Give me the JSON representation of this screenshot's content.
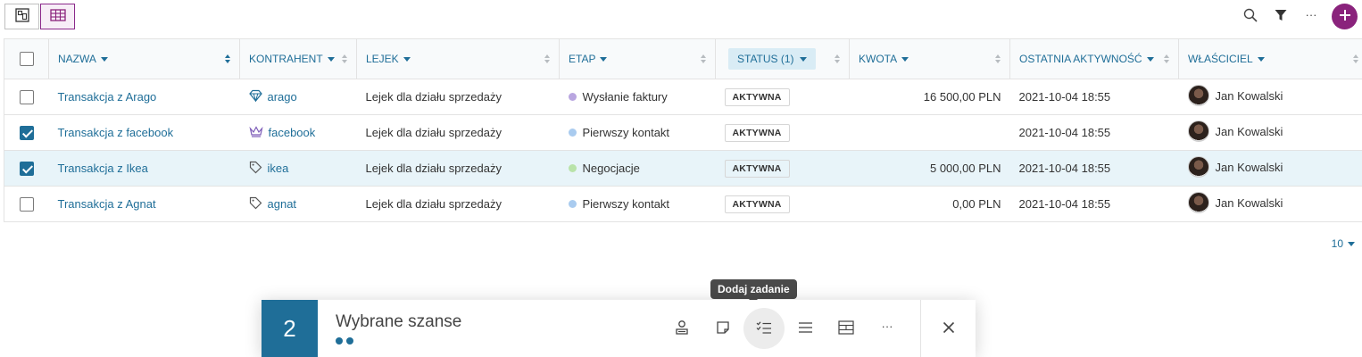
{
  "toolbar": {
    "view_toggle": [
      {
        "name": "kanban-view-icon",
        "active": false
      },
      {
        "name": "table-view-icon",
        "active": true
      }
    ],
    "actions": [
      "search-icon",
      "filter-icon",
      "more-icon",
      "add-icon"
    ],
    "more_glyph": "···",
    "accent_color": "#8a237c"
  },
  "table": {
    "columns": [
      {
        "key": "select",
        "label": ""
      },
      {
        "key": "name",
        "label": "NAZWA",
        "dropdown": true,
        "sort_active": true
      },
      {
        "key": "contractor",
        "label": "KONTRAHENT",
        "dropdown": true
      },
      {
        "key": "funnel",
        "label": "LEJEK",
        "dropdown": true
      },
      {
        "key": "stage",
        "label": "ETAP",
        "dropdown": true
      },
      {
        "key": "status",
        "label": "STATUS (1)",
        "dropdown": true,
        "filtered": true
      },
      {
        "key": "amount",
        "label": "KWOTA",
        "dropdown": true
      },
      {
        "key": "last_activity",
        "label": "OSTATNIA AKTYWNOŚĆ",
        "dropdown": true
      },
      {
        "key": "owner",
        "label": "WŁAŚCICIEL",
        "dropdown": true
      }
    ],
    "rows": [
      {
        "checked": false,
        "selected": false,
        "name": "Transakcja z Arago",
        "contractor": "arago",
        "contractor_icon": "diamond-icon",
        "funnel": "Lejek dla działu sprzedaży",
        "stage": "Wysłanie faktury",
        "stage_color": "#b9a6e0",
        "status": "AKTYWNA",
        "amount": "16 500,00 PLN",
        "last_activity": "2021-10-04 18:55",
        "owner": "Jan Kowalski"
      },
      {
        "checked": true,
        "selected": false,
        "name": "Transakcja z facebook",
        "contractor": "facebook",
        "contractor_icon": "crown-icon",
        "funnel": "Lejek dla działu sprzedaży",
        "stage": "Pierwszy kontakt",
        "stage_color": "#a9cbef",
        "status": "AKTYWNA",
        "amount": "",
        "last_activity": "2021-10-04 18:55",
        "owner": "Jan Kowalski"
      },
      {
        "checked": true,
        "selected": true,
        "name": "Transakcja z Ikea",
        "contractor": "ikea",
        "contractor_icon": "tag-icon",
        "funnel": "Lejek dla działu sprzedaży",
        "stage": "Negocjacje",
        "stage_color": "#b9e3a9",
        "status": "AKTYWNA",
        "amount": "5 000,00 PLN",
        "last_activity": "2021-10-04 18:55",
        "owner": "Jan Kowalski"
      },
      {
        "checked": false,
        "selected": false,
        "name": "Transakcja z Agnat",
        "contractor": "agnat",
        "contractor_icon": "tag-icon",
        "funnel": "Lejek dla działu sprzedaży",
        "stage": "Pierwszy kontakt",
        "stage_color": "#a9cbef",
        "status": "AKTYWNA",
        "amount": "0,00 PLN",
        "last_activity": "2021-10-04 18:55",
        "owner": "Jan Kowalski"
      }
    ],
    "page_size": "10"
  },
  "selection_bar": {
    "count": "2",
    "title": "Wybrane szanse",
    "tooltip": "Dodaj zadanie",
    "actions": [
      "assign-owner-icon",
      "note-icon",
      "add-task-icon",
      "list-icon",
      "table-edit-icon",
      "more-icon"
    ],
    "more_glyph": "···",
    "close": "close-icon",
    "accent_color": "#1f6e98"
  }
}
